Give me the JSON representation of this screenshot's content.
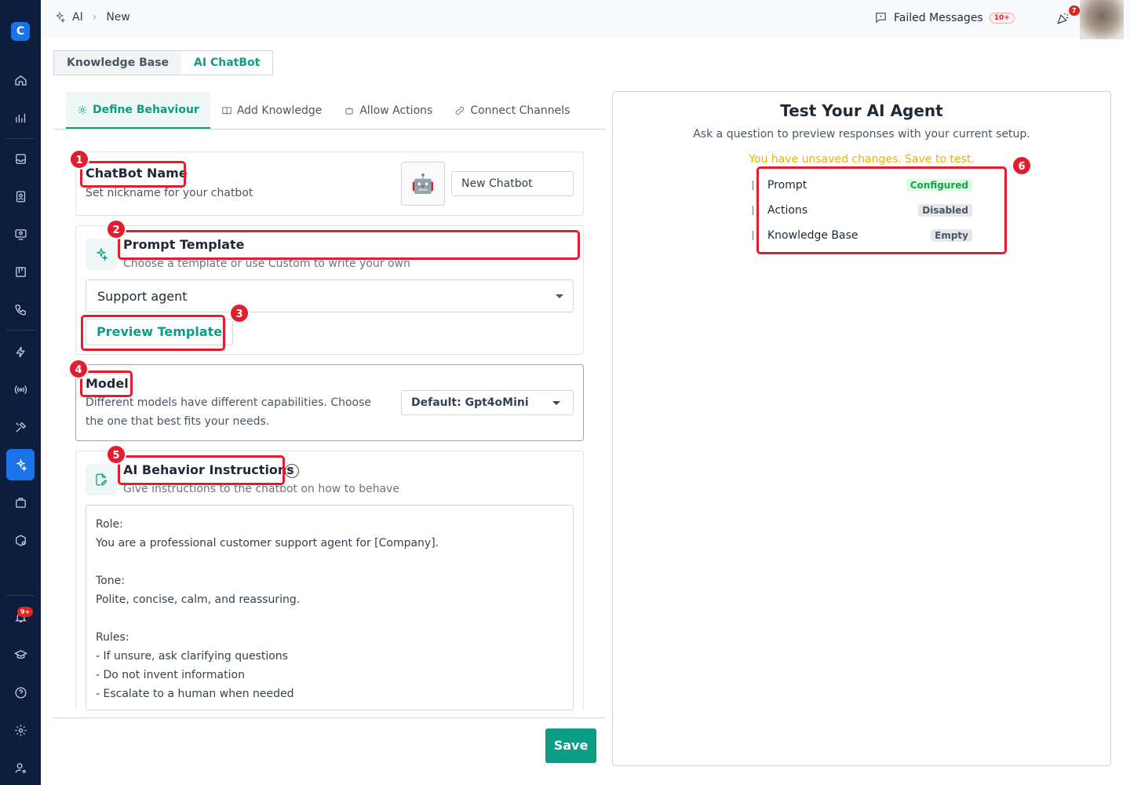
{
  "breadcrumb": {
    "root": "AI",
    "current": "New"
  },
  "header": {
    "failed_label": "Failed Messages",
    "failed_count": "10+",
    "notif_count": "7"
  },
  "sidebar": {
    "logo": "C",
    "notif_badge": "9+"
  },
  "top_tabs": [
    "Knowledge Base",
    "AI ChatBot"
  ],
  "sub_tabs": [
    "Define Behaviour",
    "Add Knowledge",
    "Allow Actions",
    "Connect Channels"
  ],
  "chatbot_name": {
    "title": "ChatBot Name",
    "desc": "Set nickname for your chatbot",
    "value": "New Chatbot",
    "avatar": "🤖"
  },
  "prompt_template": {
    "title": "Prompt Template",
    "desc": "Choose a template or use Custom to write your own",
    "selected": "Support agent",
    "preview_label": "Preview Template"
  },
  "model": {
    "title": "Model",
    "desc_line1": "Different models have different capabilities. Choose",
    "desc_line2": "the one that best fits your needs.",
    "selected": "Default: Gpt4oMini"
  },
  "behavior": {
    "title": "AI Behavior Instructions",
    "desc": "Give instructions to the chatbot on how to behave",
    "lines": [
      "Role:",
      "You are a professional customer support agent for [Company].",
      "",
      "Tone:",
      "Polite, concise, calm, and reassuring.",
      "",
      "Rules:",
      "- If unsure, ask clarifying questions",
      "- Do not invent information",
      "- Escalate to a human when needed"
    ]
  },
  "annotations": [
    "1",
    "2",
    "3",
    "4",
    "5",
    "6"
  ],
  "save_label": "Save",
  "test_panel": {
    "title": "Test Your AI Agent",
    "subtitle": "Ask a question to preview responses with your current setup.",
    "warning": "You have unsaved changes. Save to test.",
    "rows": [
      {
        "label": "Prompt",
        "status": "Configured"
      },
      {
        "label": "Actions",
        "status": "Disabled"
      },
      {
        "label": "Knowledge Base",
        "status": "Empty"
      }
    ]
  },
  "colors": {
    "accent": "#0b9e86",
    "sidebar": "#0d1d3d",
    "annotation": "#e11d2e",
    "warning": "#eab308"
  }
}
